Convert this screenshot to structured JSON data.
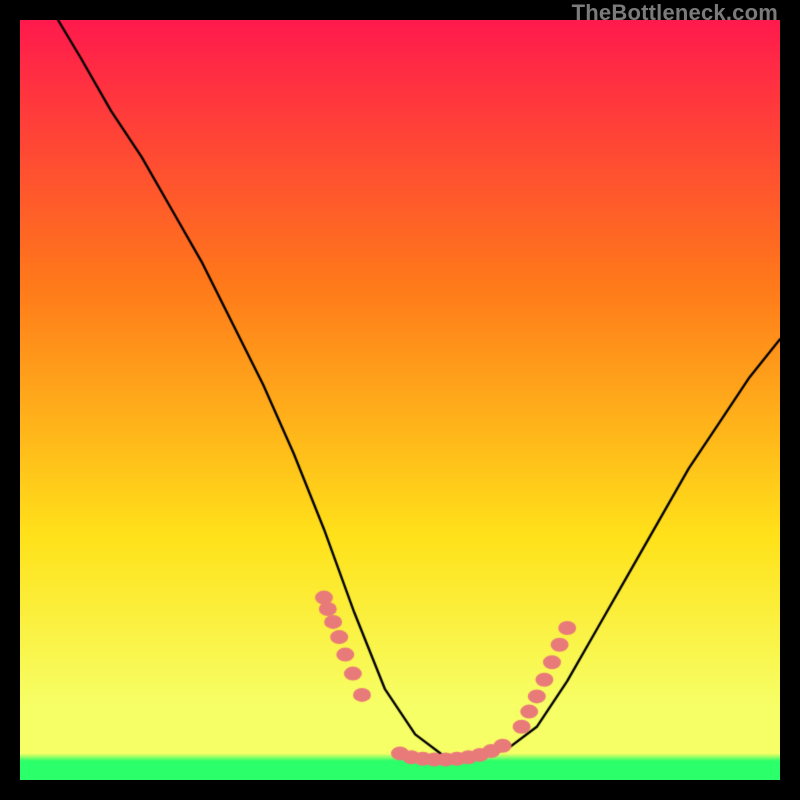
{
  "watermark": "TheBottleneck.com",
  "chart_data": {
    "type": "line",
    "title": "",
    "xlabel": "",
    "ylabel": "",
    "xlim": [
      0,
      100
    ],
    "ylim": [
      0,
      100
    ],
    "grid": false,
    "legend": false,
    "background_gradient": {
      "top": "#ff1a4d",
      "mid1": "#ff7a1a",
      "mid2": "#ffe21a",
      "bottom_yellow": "#f7ff66",
      "bottom_green": "#2bff6a"
    },
    "series": [
      {
        "name": "curve",
        "type": "line",
        "color": "#000000",
        "x": [
          5,
          8,
          12,
          16,
          20,
          24,
          28,
          32,
          36,
          40,
          44,
          48,
          52,
          56,
          60,
          64,
          68,
          72,
          76,
          80,
          84,
          88,
          92,
          96,
          100
        ],
        "y": [
          100,
          95,
          88,
          82,
          75,
          68,
          60,
          52,
          43,
          33,
          22,
          12,
          6,
          3,
          3,
          4,
          7,
          13,
          20,
          27,
          34,
          41,
          47,
          53,
          58
        ]
      },
      {
        "name": "left-cluster-dots",
        "type": "scatter",
        "color": "#e97a7a",
        "x": [
          40.0,
          40.5,
          41.2,
          42.0,
          42.8,
          43.8,
          45.0
        ],
        "y": [
          24.0,
          22.5,
          20.8,
          18.8,
          16.5,
          14.0,
          11.2
        ]
      },
      {
        "name": "bottom-cluster-dots",
        "type": "scatter",
        "color": "#e97a7a",
        "x": [
          50.0,
          51.5,
          53.0,
          54.5,
          56.0,
          57.5,
          59.0,
          60.5,
          62.0,
          63.5
        ],
        "y": [
          3.5,
          3.0,
          2.8,
          2.7,
          2.7,
          2.8,
          3.0,
          3.3,
          3.8,
          4.5
        ]
      },
      {
        "name": "right-cluster-dots",
        "type": "scatter",
        "color": "#e97a7a",
        "x": [
          66.0,
          67.0,
          68.0,
          69.0,
          70.0,
          71.0,
          72.0
        ],
        "y": [
          7.0,
          9.0,
          11.0,
          13.2,
          15.5,
          17.8,
          20.0
        ]
      }
    ]
  }
}
